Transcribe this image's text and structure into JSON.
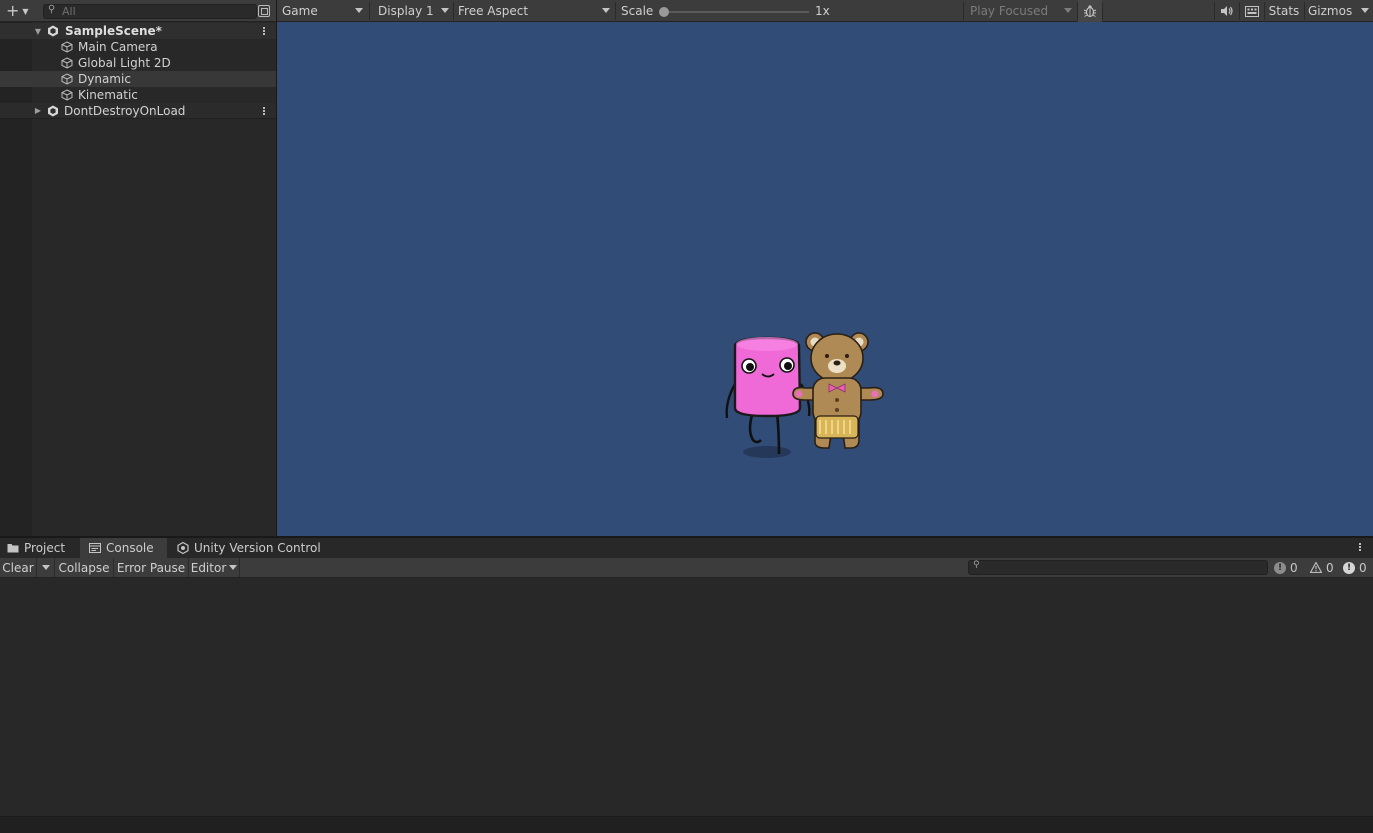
{
  "hierarchy": {
    "search_placeholder": "All",
    "items": [
      {
        "label": "SampleScene*",
        "type": "scene",
        "expanded": true
      },
      {
        "label": "Main Camera",
        "type": "gameobject"
      },
      {
        "label": "Global Light 2D",
        "type": "gameobject"
      },
      {
        "label": "Dynamic",
        "type": "gameobject",
        "selected": true
      },
      {
        "label": "Kinematic",
        "type": "gameobject"
      },
      {
        "label": "DontDestroyOnLoad",
        "type": "scene",
        "expanded": false
      }
    ]
  },
  "game_toolbar": {
    "view_mode": "Game",
    "display": "Display 1",
    "aspect": "Free Aspect",
    "scale_label": "Scale",
    "scale_value": "1x",
    "play_mode": "Play Focused",
    "stats_label": "Stats",
    "gizmos_label": "Gizmos"
  },
  "game_view": {
    "background_color": "#314c77",
    "sprites": [
      "pink-marshmallow-character",
      "gingerbread-bear-character"
    ]
  },
  "bottom_panel": {
    "tabs": [
      {
        "label": "Project",
        "icon": "folder-icon"
      },
      {
        "label": "Console",
        "icon": "console-icon",
        "active": true
      },
      {
        "label": "Unity Version Control",
        "icon": "version-control-icon"
      }
    ],
    "console_toolbar": {
      "clear_label": "Clear",
      "collapse_label": "Collapse",
      "error_pause_label": "Error Pause",
      "editor_label": "Editor"
    },
    "counts": {
      "info": "0",
      "warnings": "0",
      "errors": "0"
    }
  }
}
